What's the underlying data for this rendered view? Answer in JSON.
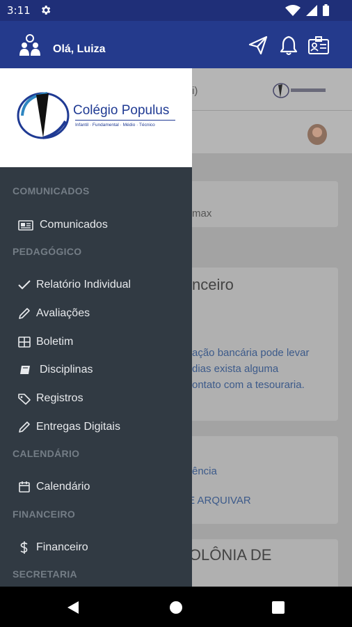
{
  "status_bar": {
    "time": "3:11",
    "icons": [
      "gear-icon",
      "wifi-icon",
      "signal-icon",
      "battery-icon"
    ]
  },
  "header": {
    "greeting": "Olá, Luiza",
    "icons": [
      "users-icon",
      "send-icon",
      "bell-icon",
      "id-card-icon"
    ],
    "background": "#243a8c"
  },
  "drawer": {
    "brand": {
      "name": "Colégio Populus",
      "tagline": "Infantil · Fundamental · Médio · Técnico"
    },
    "sections": [
      {
        "title": "COMUNICADOS",
        "items": [
          {
            "label": "Comunicados",
            "icon": "newspaper-icon"
          }
        ]
      },
      {
        "title": "PEDAGÓGICO",
        "items": [
          {
            "label": "Relatório Individual",
            "icon": "check-icon"
          },
          {
            "label": "Avaliações",
            "icon": "pencil-icon"
          },
          {
            "label": "Boletim",
            "icon": "table-icon"
          },
          {
            "label": "Disciplinas",
            "icon": "book-icon"
          },
          {
            "label": "Registros",
            "icon": "tag-icon"
          },
          {
            "label": "Entregas Digitais",
            "icon": "pencil-icon"
          }
        ]
      },
      {
        "title": "CALENDÁRIO",
        "items": [
          {
            "label": "Calendário",
            "icon": "calendar-icon"
          }
        ]
      },
      {
        "title": "FINANCEIRO",
        "items": [
          {
            "label": "Financeiro",
            "icon": "dollar-icon"
          }
        ]
      },
      {
        "title": "SECRETARIA",
        "items": []
      }
    ]
  },
  "background": {
    "fragments": [
      "i)",
      "max",
      "nceiro",
      "ação bancária pode levar",
      "dias exista alguma",
      "ontato com a tesouraria.",
      "ência",
      "E E ARQUIVAR",
      "COLÔNIA DE"
    ]
  },
  "nav_bar": {
    "icons": [
      "back-icon",
      "home-icon",
      "recents-icon"
    ]
  }
}
